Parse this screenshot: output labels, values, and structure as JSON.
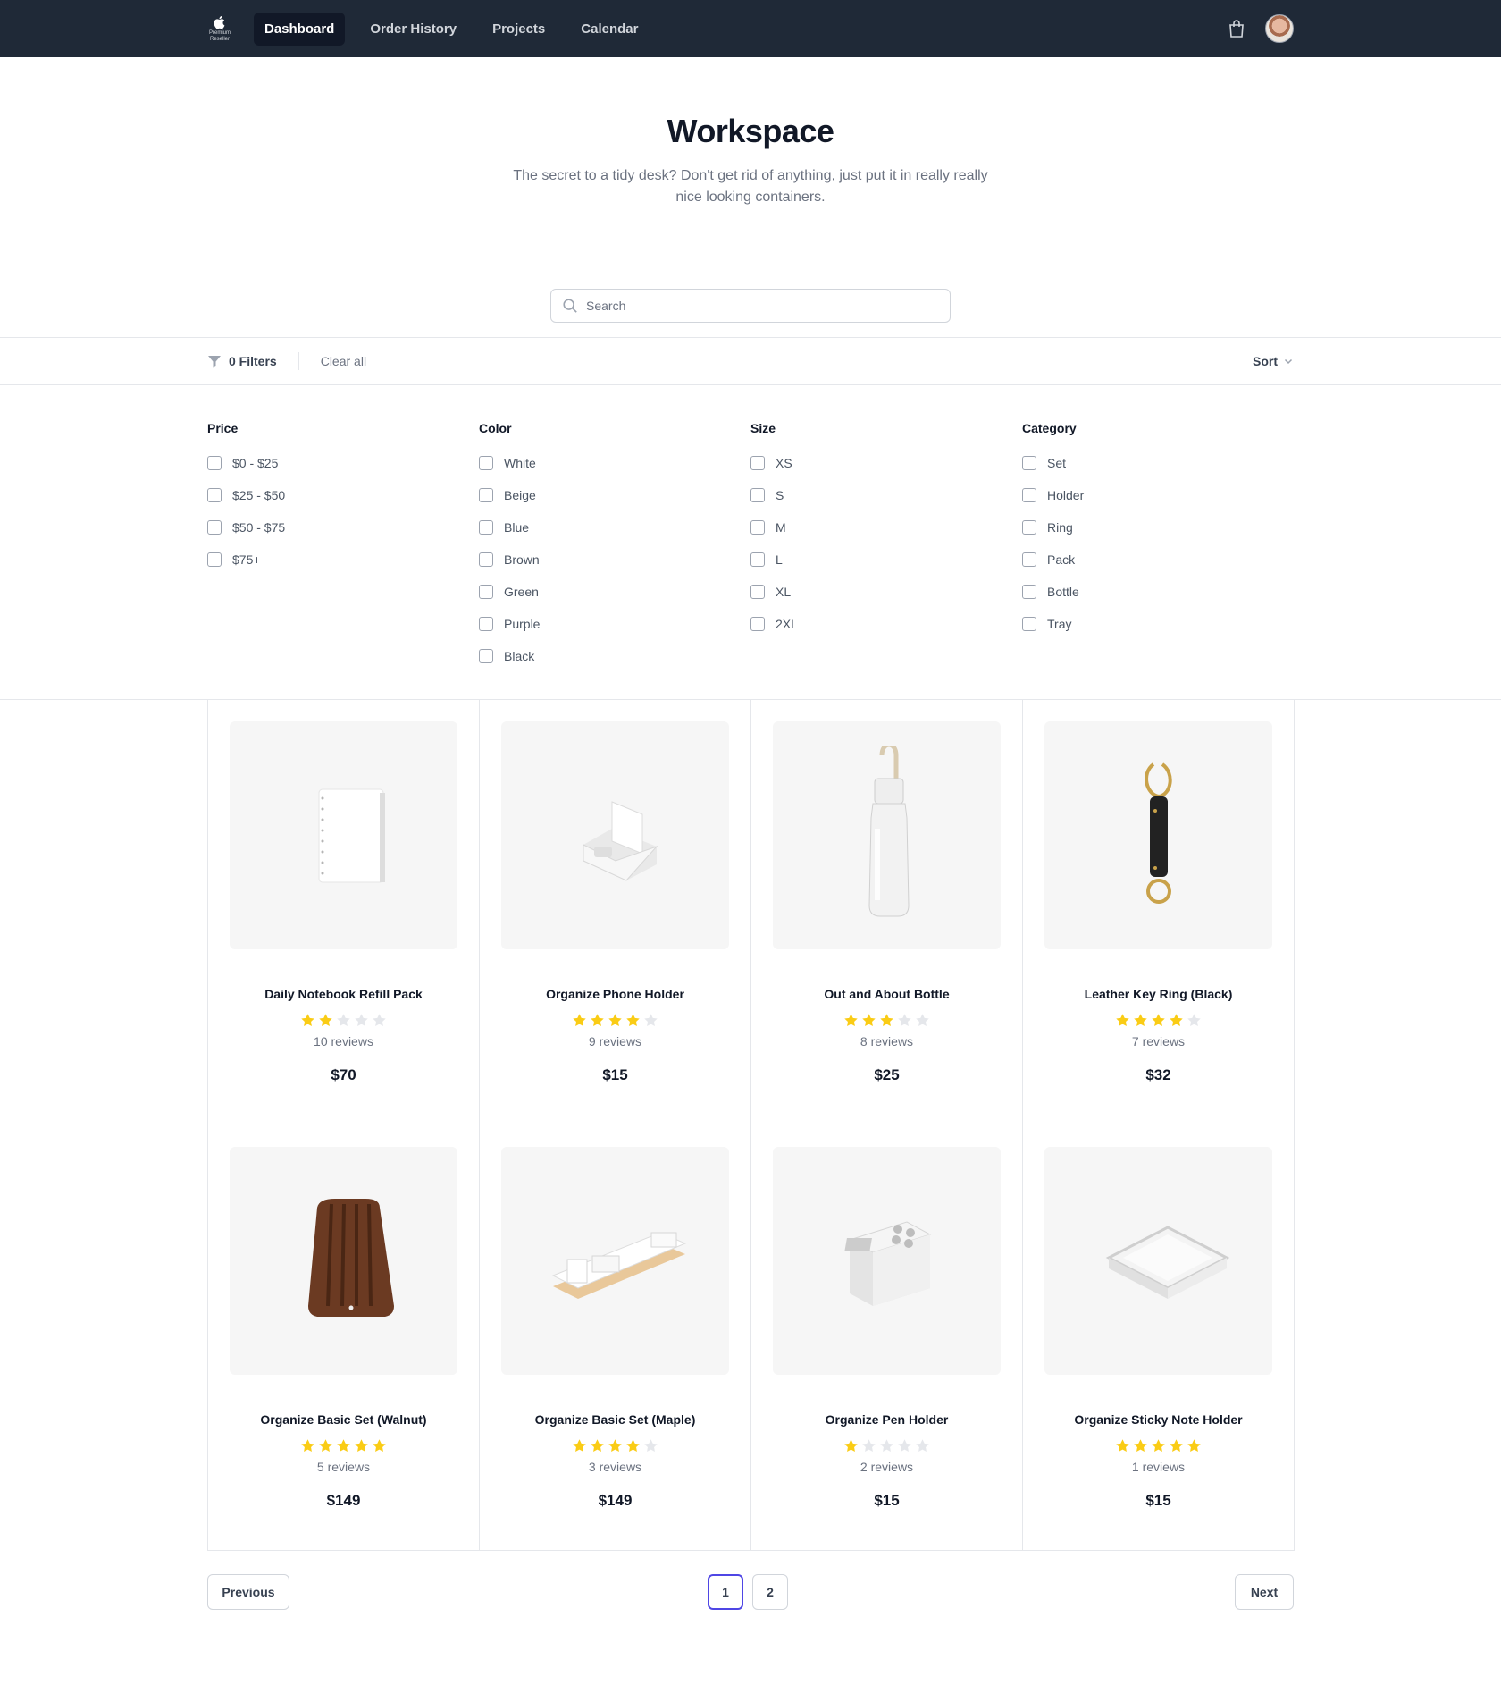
{
  "nav": {
    "logo_tag": "Premium\nReseller",
    "links": [
      "Dashboard",
      "Order History",
      "Projects",
      "Calendar"
    ],
    "active_index": 0
  },
  "hero": {
    "title": "Workspace",
    "subtitle": "The secret to a tidy desk? Don't get rid of anything, just put it in really really nice looking containers."
  },
  "search": {
    "placeholder": "Search",
    "value": ""
  },
  "filter_bar": {
    "filters_label": "0 Filters",
    "clear_label": "Clear all",
    "sort_label": "Sort"
  },
  "filters": [
    {
      "title": "Price",
      "options": [
        "$0 - $25",
        "$25 - $50",
        "$50 - $75",
        "$75+"
      ]
    },
    {
      "title": "Color",
      "options": [
        "White",
        "Beige",
        "Blue",
        "Brown",
        "Green",
        "Purple",
        "Black"
      ]
    },
    {
      "title": "Size",
      "options": [
        "XS",
        "S",
        "M",
        "L",
        "XL",
        "2XL"
      ]
    },
    {
      "title": "Category",
      "options": [
        "Set",
        "Holder",
        "Ring",
        "Pack",
        "Bottle",
        "Tray"
      ]
    }
  ],
  "products": [
    {
      "name": "Daily Notebook Refill Pack",
      "rating": 2,
      "reviews": "10 reviews",
      "price": "$70",
      "image": "notebook"
    },
    {
      "name": "Organize Phone Holder",
      "rating": 4,
      "reviews": "9 reviews",
      "price": "$15",
      "image": "phone-holder"
    },
    {
      "name": "Out and About Bottle",
      "rating": 3,
      "reviews": "8 reviews",
      "price": "$25",
      "image": "bottle"
    },
    {
      "name": "Leather Key Ring (Black)",
      "rating": 4,
      "reviews": "7 reviews",
      "price": "$32",
      "image": "key-ring"
    },
    {
      "name": "Organize Basic Set (Walnut)",
      "rating": 5,
      "reviews": "5 reviews",
      "price": "$149",
      "image": "walnut-tray"
    },
    {
      "name": "Organize Basic Set (Maple)",
      "rating": 4,
      "reviews": "3 reviews",
      "price": "$149",
      "image": "maple-set"
    },
    {
      "name": "Organize Pen Holder",
      "rating": 1,
      "reviews": "2 reviews",
      "price": "$15",
      "image": "pen-holder"
    },
    {
      "name": "Organize Sticky Note Holder",
      "rating": 5,
      "reviews": "1 reviews",
      "price": "$15",
      "image": "sticky-holder"
    }
  ],
  "pagination": {
    "previous": "Previous",
    "next": "Next",
    "pages": [
      "1",
      "2"
    ],
    "current": "1"
  },
  "colors": {
    "nav_bg": "#1f2937",
    "star_on": "#facc15",
    "star_off": "#e5e7eb",
    "accent": "#4f46e5"
  }
}
